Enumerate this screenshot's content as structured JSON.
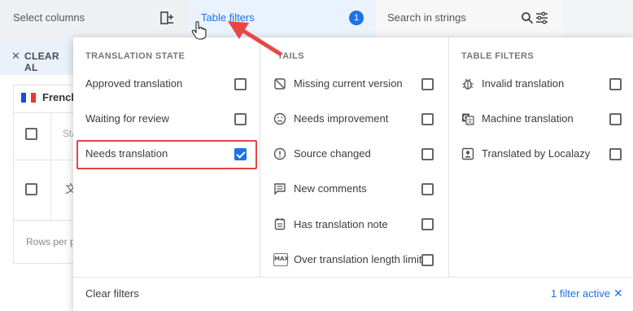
{
  "toolbar": {
    "select_columns": "Select columns",
    "table_filters": "Table filters",
    "filter_badge": "1",
    "search_placeholder": "Search in strings"
  },
  "background": {
    "clear_all": "CLEAR AL",
    "language": "French",
    "status_header": "Sta",
    "rows_per_page": "Rows per p",
    "translate_glyph": "文"
  },
  "panel": {
    "sections": {
      "translation_state": "TRANSLATION STATE",
      "details": "TAILS",
      "table_filters": "TABLE FILTERS"
    },
    "translation_state": [
      {
        "label": "Approved translation",
        "checked": false
      },
      {
        "label": "Waiting for review",
        "checked": false
      },
      {
        "label": "Needs translation",
        "checked": true
      }
    ],
    "details": [
      {
        "label": "Missing current version",
        "icon": "no-version-icon",
        "checked": false
      },
      {
        "label": "Needs improvement",
        "icon": "sad-face-icon",
        "checked": false
      },
      {
        "label": "Source changed",
        "icon": "exclamation-circle-icon",
        "checked": false
      },
      {
        "label": "New comments",
        "icon": "comment-icon",
        "checked": false
      },
      {
        "label": "Has translation note",
        "icon": "note-icon",
        "checked": false
      },
      {
        "label": "Over translation length limit",
        "icon": "max-icon",
        "icon_text": "MAX",
        "checked": false
      }
    ],
    "table_filters": [
      {
        "label": "Invalid translation",
        "icon": "bug-icon",
        "checked": false
      },
      {
        "label": "Machine translation",
        "icon": "google-translate-icon",
        "checked": false
      },
      {
        "label": "Translated by Localazy",
        "icon": "badge-icon",
        "checked": false
      }
    ],
    "clear_filters": "Clear filters",
    "active_filters": "1 filter active",
    "close_glyph": "✕"
  },
  "colors": {
    "accent": "#1a73e8",
    "highlight": "#e84545"
  }
}
